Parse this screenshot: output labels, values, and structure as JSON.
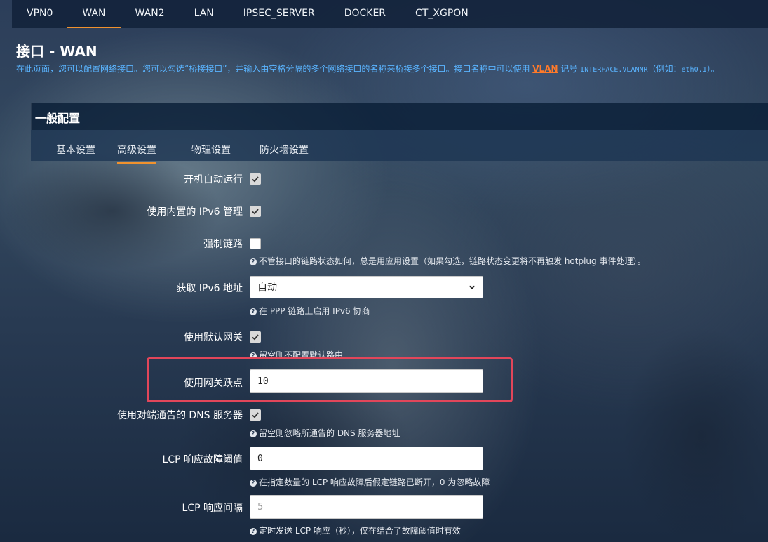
{
  "top_tabs": [
    "VPN0",
    "WAN",
    "WAN2",
    "LAN",
    "IPSEC_SERVER",
    "DOCKER",
    "CT_XGPON"
  ],
  "active_tab": "WAN",
  "page": {
    "title": "接口 - WAN",
    "desc_before": "在此页面，您可以配置网络接口。您可以勾选“桥接接口”，并输入由空格分隔的多个网络接口的名称来桥接多个接口。接口名称中可以使用 ",
    "desc_link": "VLAN",
    "desc_mid": " 记号 ",
    "desc_mono": "INTERFACE.VLANNR",
    "desc_after1": "（例如：",
    "desc_mono2": "eth0.1",
    "desc_after2": "）。"
  },
  "section": {
    "title": "一般配置",
    "subtabs": [
      "基本设置",
      "高级设置",
      "物理设置",
      "防火墙设置"
    ],
    "active_subtab": "高级设置"
  },
  "form": {
    "autostart_label": "开机自动运行",
    "autostart_checked": true,
    "ipv6_label": "使用内置的 IPv6 管理",
    "ipv6_checked": true,
    "force_link_label": "强制链路",
    "force_link_checked": false,
    "force_link_help": "不管接口的链路状态如何，总是用应用设置（如果勾选，链路状态变更将不再触发 hotplug 事件处理）。",
    "get_ipv6_label": "获取 IPv6 地址",
    "get_ipv6_value": "自动",
    "get_ipv6_help": "在 PPP 链路上启用 IPv6 协商",
    "default_gw_label": "使用默认网关",
    "default_gw_checked": true,
    "default_gw_help": "留空则不配置默认路由",
    "metric_label": "使用网关跃点",
    "metric_value": "10",
    "peer_dns_label": "使用对端通告的 DNS 服务器",
    "peer_dns_checked": true,
    "peer_dns_help": "留空则忽略所通告的 DNS 服务器地址",
    "lcp_fail_label": "LCP 响应故障阈值",
    "lcp_fail_value": "0",
    "lcp_fail_help": "在指定数量的 LCP 响应故障后假定链路已断开，0 为忽略故障",
    "lcp_interval_label": "LCP 响应间隔",
    "lcp_interval_placeholder": "5",
    "lcp_interval_help": "定时发送 LCP 响应（秒），仅在结合了故障阈值时有效"
  },
  "colors": {
    "accent": "#f0922e",
    "link": "#5ab4ff",
    "highlight": "#e2465a"
  },
  "icons": {
    "check": "check-icon",
    "help": "help-circle-icon",
    "dropdown": "chevron-down-icon"
  }
}
